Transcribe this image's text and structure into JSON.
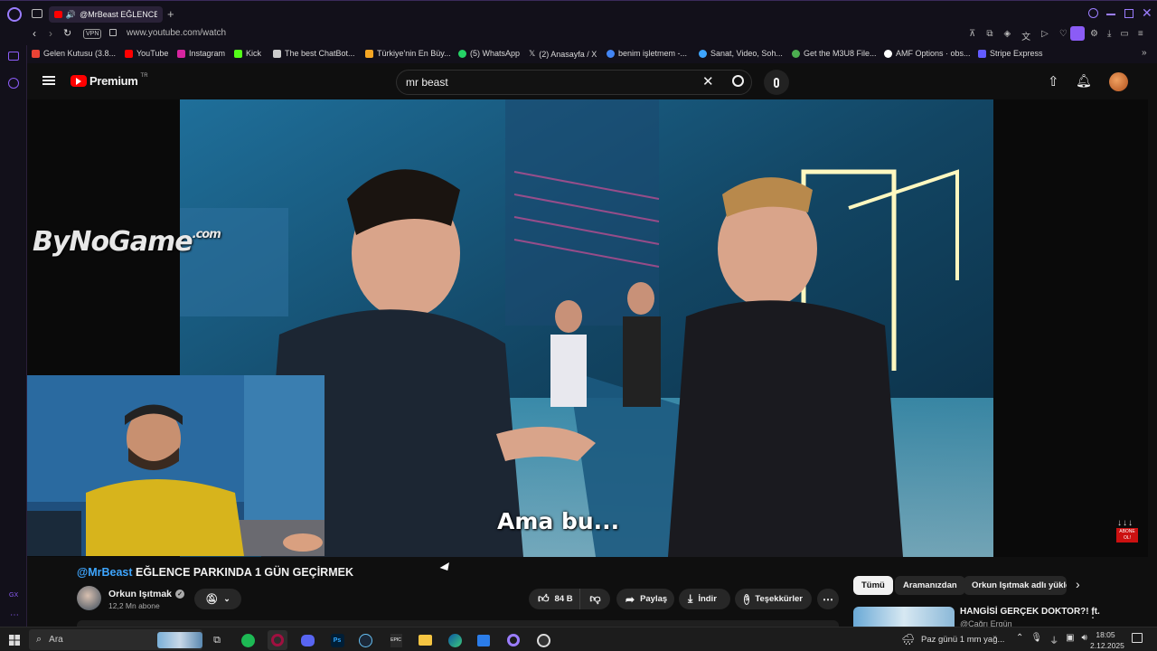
{
  "browser": {
    "active_tab_title": "@MrBeast EĞLENCE P",
    "url": "www.youtube.com/watch",
    "vpn_label": "VPN"
  },
  "bookmarks": [
    {
      "label": "Gelen Kutusu (3.8...",
      "icon": "gmail-icon",
      "color": "#ea4335"
    },
    {
      "label": "YouTube",
      "icon": "youtube-icon",
      "color": "#ff0000"
    },
    {
      "label": "Instagram",
      "icon": "instagram-icon",
      "color": "#d6249f"
    },
    {
      "label": "Kick",
      "icon": "kick-icon",
      "color": "#53fc18"
    },
    {
      "label": "The best ChatBot...",
      "icon": "chatbot-icon",
      "color": "#cccccc"
    },
    {
      "label": "Türkiye'nin En Büy...",
      "icon": "store-icon",
      "color": "#f5a623"
    },
    {
      "label": "(5) WhatsApp",
      "icon": "whatsapp-icon",
      "color": "#25d366"
    },
    {
      "label": "(2) Anasayfa / X",
      "icon": "x-icon",
      "color": "#ffffff"
    },
    {
      "label": "benim işletmem -...",
      "icon": "google-icon",
      "color": "#4285f4"
    },
    {
      "label": "Sanat, Video, Soh...",
      "icon": "globe-icon",
      "color": "#3ea6ff"
    },
    {
      "label": "Get the M3U8 File...",
      "icon": "m3u8-icon",
      "color": "#4caf50"
    },
    {
      "label": "AMF Options · obs...",
      "icon": "github-icon",
      "color": "#ffffff"
    },
    {
      "label": "Stripe Express",
      "icon": "stripe-icon",
      "color": "#635bff"
    }
  ],
  "youtube": {
    "logo_text": "Premium",
    "logo_region": "TR",
    "search_value": "mr beast"
  },
  "video": {
    "watermark": "ByNoGame",
    "watermark_suffix": ".com",
    "subtitle": "Ama bu...",
    "subscribe_badge": "ABONE OL!",
    "title_mention": "@MrBeast",
    "title_rest": " EĞLENCE PARKINDA 1 GÜN GEÇİRMEK"
  },
  "channel": {
    "name": "Orkun Işıtmak",
    "subscribers": "12,2 Mn abone"
  },
  "actions": {
    "like_count": "84 B",
    "share": "Paylaş",
    "download": "İndir",
    "thanks": "Teşekkürler"
  },
  "chips": [
    "Tümü",
    "Aramanızdan",
    "Orkun Işıtmak adlı yükle"
  ],
  "recommended": {
    "title": "HANGİSİ GERÇEK DOKTOR?! ft.",
    "channel": "@Çağrı Ergün"
  },
  "taskbar": {
    "search_placeholder": "Ara",
    "weather": "Paz günü 1 mm yağ...",
    "time": "18:05",
    "date": "2.12.2025"
  },
  "colors": {
    "accent": "#3ea6ff",
    "youtube_red": "#ff0000",
    "opera_purple": "#8b5cf6"
  }
}
